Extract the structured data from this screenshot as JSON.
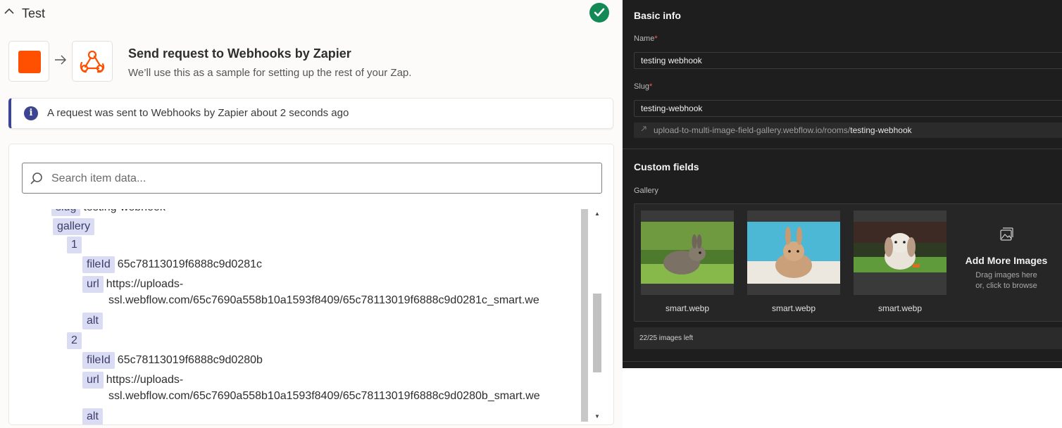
{
  "left": {
    "section_title": "Test",
    "step": {
      "title": "Send request to Webhooks by Zapier",
      "subtitle": "We’ll use this as a sample for setting up the rest of your Zap."
    },
    "alert": "A request was sent to Webhooks by Zapier about 2 seconds ago",
    "search_placeholder": "Search item data...",
    "tree": {
      "slug_key": "slug",
      "slug_value": "testing-webhook",
      "gallery_key": "gallery",
      "items": [
        {
          "index": "1",
          "fileId_key": "fileId",
          "fileId": "65c78113019f6888c9d0281c",
          "url_key": "url",
          "url_line1": "https://uploads-",
          "url_line2": "ssl.webflow.com/65c7690a558b10a1593f8409/65c78113019f6888c9d0281c_smart.we",
          "alt_key": "alt"
        },
        {
          "index": "2",
          "fileId_key": "fileId",
          "fileId": "65c78113019f6888c9d0280b",
          "url_key": "url",
          "url_line1": "https://uploads-",
          "url_line2": "ssl.webflow.com/65c7690a558b10a1593f8409/65c78113019f6888c9d0280b_smart.we",
          "alt_key": "alt"
        }
      ]
    }
  },
  "right": {
    "basic_info": "Basic info",
    "name_label": "Name",
    "name_value": "testing webhook",
    "slug_label": "Slug",
    "slug_value": "testing-webhook",
    "url_prefix": "upload-to-multi-image-field-gallery.webflow.io/rooms/",
    "url_slug": "testing-webhook",
    "custom_fields": "Custom fields",
    "gallery_label": "Gallery",
    "images": [
      {
        "caption": "smart.webp"
      },
      {
        "caption": "smart.webp"
      },
      {
        "caption": "smart.webp"
      }
    ],
    "add_more_title": "Add More Images",
    "add_more_hint1": "Drag images here",
    "add_more_hint2": "or, click to browse",
    "images_left": "22/25 images left"
  },
  "colors": {
    "zapier_orange": "#ff4f00",
    "success_green": "#138a56",
    "info_indigo": "#3d4592",
    "key_chip": "#dadcf4",
    "webflow_bg": "#1e1e1e"
  }
}
